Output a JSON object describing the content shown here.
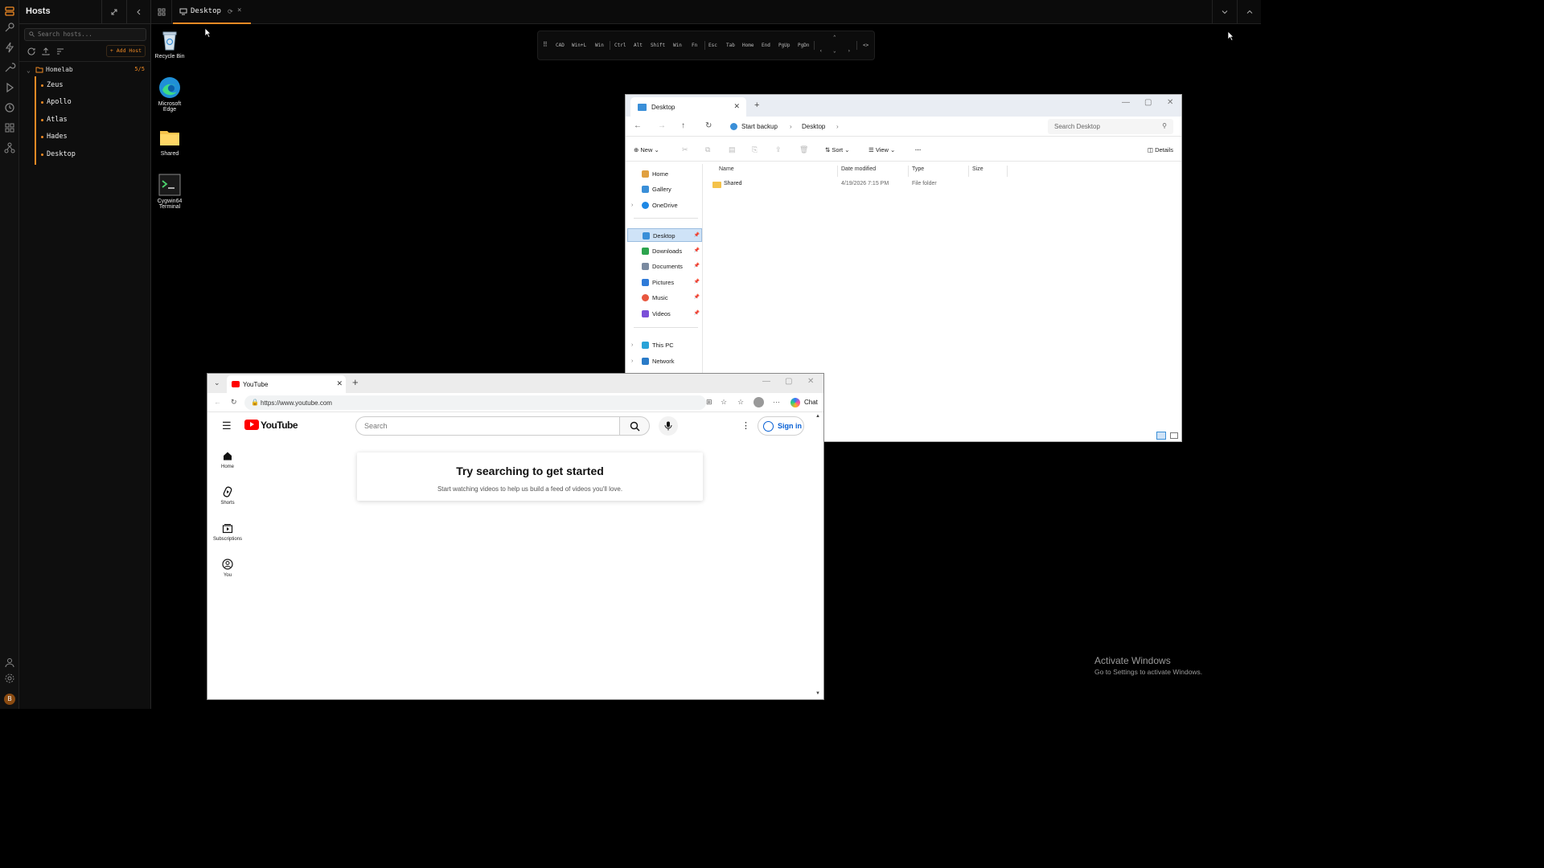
{
  "sidebar": {
    "title": "Hosts",
    "search_placeholder": "Search hosts...",
    "add_host_label": "+ Add Host",
    "group": {
      "name": "Homelab",
      "count": "5/5"
    },
    "hosts": [
      "Zeus",
      "Apollo",
      "Atlas",
      "Hades",
      "Desktop"
    ]
  },
  "tabbar": {
    "active_tab": "Desktop"
  },
  "desktop_icons": [
    {
      "label": "Recycle Bin",
      "icon": "recycle-bin-icon"
    },
    {
      "label": "Microsoft Edge",
      "icon": "edge-icon"
    },
    {
      "label": "Shared",
      "icon": "folder-icon"
    },
    {
      "label": "Cygwin64 Terminal",
      "icon": "terminal-icon"
    }
  ],
  "virtual_keys": [
    "CAD",
    "Win+L",
    "Win",
    "Ctrl",
    "Alt",
    "Shift",
    "Win",
    "Fn",
    "Esc",
    "Tab",
    "Home",
    "End",
    "PgUp",
    "PgDn"
  ],
  "explorer": {
    "tab_title": "Desktop",
    "breadcrumb": [
      "Start backup",
      "Desktop"
    ],
    "search_placeholder": "Search Desktop",
    "commands": {
      "new": "New",
      "sort": "Sort",
      "view": "View",
      "details": "Details"
    },
    "nav": {
      "top": [
        "Home",
        "Gallery",
        "OneDrive"
      ],
      "pinned": [
        "Desktop",
        "Downloads",
        "Documents",
        "Pictures",
        "Music",
        "Videos"
      ],
      "bottom": [
        "This PC",
        "Network"
      ]
    },
    "columns": [
      "Name",
      "Date modified",
      "Type",
      "Size"
    ],
    "rows": [
      {
        "name": "Shared",
        "date": "4/19/2026 7:15 PM",
        "type": "File folder",
        "size": ""
      }
    ]
  },
  "browser": {
    "tab_title": "YouTube",
    "url": "https://www.youtube.com",
    "chat_label": "Chat",
    "youtube": {
      "logo": "YouTube",
      "search_placeholder": "Search",
      "signin": "Sign in",
      "sidebar": [
        "Home",
        "Shorts",
        "Subscriptions",
        "You"
      ],
      "card_title": "Try searching to get started",
      "card_subtitle": "Start watching videos to help us build a feed of videos you'll love."
    }
  },
  "watermark": {
    "title": "Activate Windows",
    "subtitle": "Go to Settings to activate Windows."
  },
  "colors": {
    "accent": "#f08a24",
    "youtube_red": "#ff0000",
    "link_blue": "#065fd4"
  }
}
